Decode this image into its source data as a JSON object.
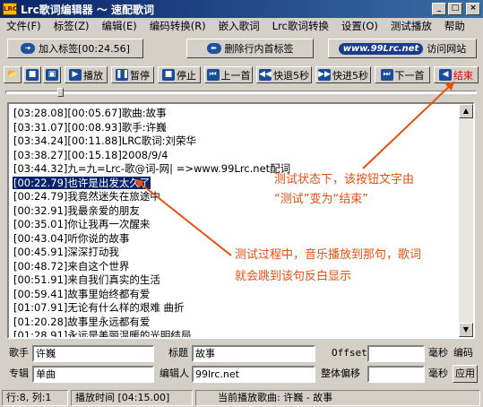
{
  "window": {
    "title": "Lrc歌词编辑器 ～ 速配歌词",
    "app_icon_text": "LRC",
    "minimize": "_",
    "maximize": "□",
    "close": "×"
  },
  "menu": [
    "文件(F)",
    "标签(Z)",
    "编辑(E)",
    "编码转换(R)",
    "嵌入歌词",
    "Lrc歌词转换",
    "设置(O)",
    "测试播放",
    "帮助"
  ],
  "toolbar1": {
    "add_tag": "加入标签[00:24.56]",
    "delete_tag": "删除行内首标签",
    "site_logo": "www.99Lrc.net",
    "visit_site": "访问网站"
  },
  "toolbar2": {
    "play": "播放",
    "pause": "暂停",
    "stop": "停止",
    "prev_line": "上一首",
    "rewind": "快退5秒",
    "forward": "快进5秒",
    "next_track": "下一首",
    "end": "结束"
  },
  "lyrics": [
    "[03:28.08][00:05.67]歌曲:故事",
    "[03:31.07][00:08.93]歌手:许巍",
    "[03:34.24][00:11.88]LRC歌词:刘荣华",
    "[03:38.27][00:15.18]2008/9/4",
    "[03:44.32]九=九=Lrc-歌@词-网| =>www.99Lrc.net配词",
    "[00:22.79]也许是出发太久了",
    "[00:24.79]我竟然迷失在旅途中",
    "[00:32.91]我最亲爱的朋友",
    "[00:35.01]你让我再一次醒来",
    "[00:43.04]听你说的故事",
    "[00:45.91]深深打动我",
    "[00:48.72]来自这个世界",
    "[00:51.91]来自我们真实的生活",
    "[00:59.41]故事里始终都有爱",
    "[01:07.91]无论有什么样的艰难 曲折",
    "[01:20.28]故事里永远都有爱",
    "[01:28.91]永远是美丽温暖的光明结局"
  ],
  "selected_line": 5,
  "annotations": {
    "note1": "测试状态下，该按钮文字由",
    "note2": "“测试”变为“结束”",
    "note3": "测试过程中，音乐播放到那句，歌词",
    "note4": "就会跳到该句反白显示"
  },
  "form": {
    "singer_label": "歌手",
    "singer_value": "许巍",
    "title_label": "标题",
    "title_value": "故事",
    "offset_label": "Offset",
    "offset_value": "",
    "ms_label1": "毫秒",
    "encode_label": "编码",
    "album_label": "专辑",
    "album_value": "单曲",
    "editor_label": "编辑人",
    "editor_value": "99lrc.net",
    "global_offset_label": "整体偏移",
    "global_offset_value": "",
    "ms_label2": "毫秒",
    "apply_label": "应用"
  },
  "status": {
    "position": "行:8, 列:1",
    "play_time": "播放时间 [04:15.00]",
    "current_song": "当前播放歌曲: 许巍 - 故事"
  },
  "colors": {
    "title_start": "#0a246a",
    "title_end": "#3a6ea5",
    "selection": "#0a246a",
    "annotation": "#e85010",
    "end_label": "#e00000"
  }
}
